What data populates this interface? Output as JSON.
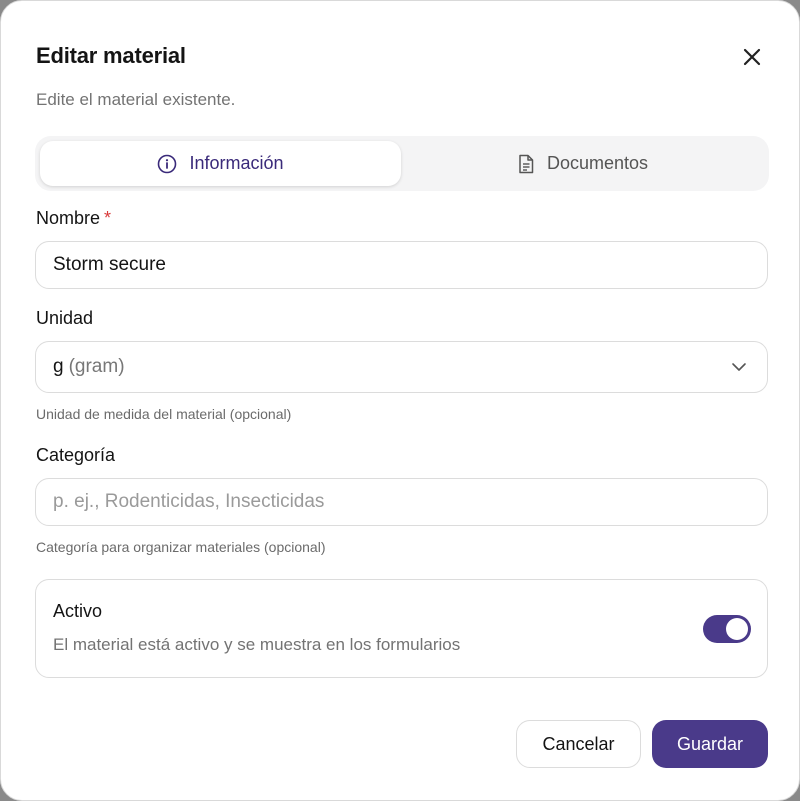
{
  "dialog": {
    "title": "Editar material",
    "subtitle": "Edite el material existente."
  },
  "tabs": [
    {
      "label": "Información",
      "icon": "info-icon",
      "active": true
    },
    {
      "label": "Documentos",
      "icon": "document-icon",
      "active": false
    }
  ],
  "form": {
    "name": {
      "label": "Nombre",
      "required_marker": "*",
      "value": "Storm secure"
    },
    "unit": {
      "label": "Unidad",
      "value_symbol": "g",
      "value_name": "(gram)",
      "hint": "Unidad de medida del material (opcional)"
    },
    "category": {
      "label": "Categoría",
      "placeholder": "p. ej., Rodenticidas, Insecticidas",
      "value": "",
      "hint": "Categoría para organizar materiales (opcional)"
    },
    "active": {
      "title": "Activo",
      "description": "El material está activo y se muestra en los formularios",
      "checked": true
    }
  },
  "buttons": {
    "cancel": "Cancelar",
    "save": "Guardar"
  },
  "colors": {
    "accent": "#4a3a8a",
    "required": "#d93a3a"
  }
}
